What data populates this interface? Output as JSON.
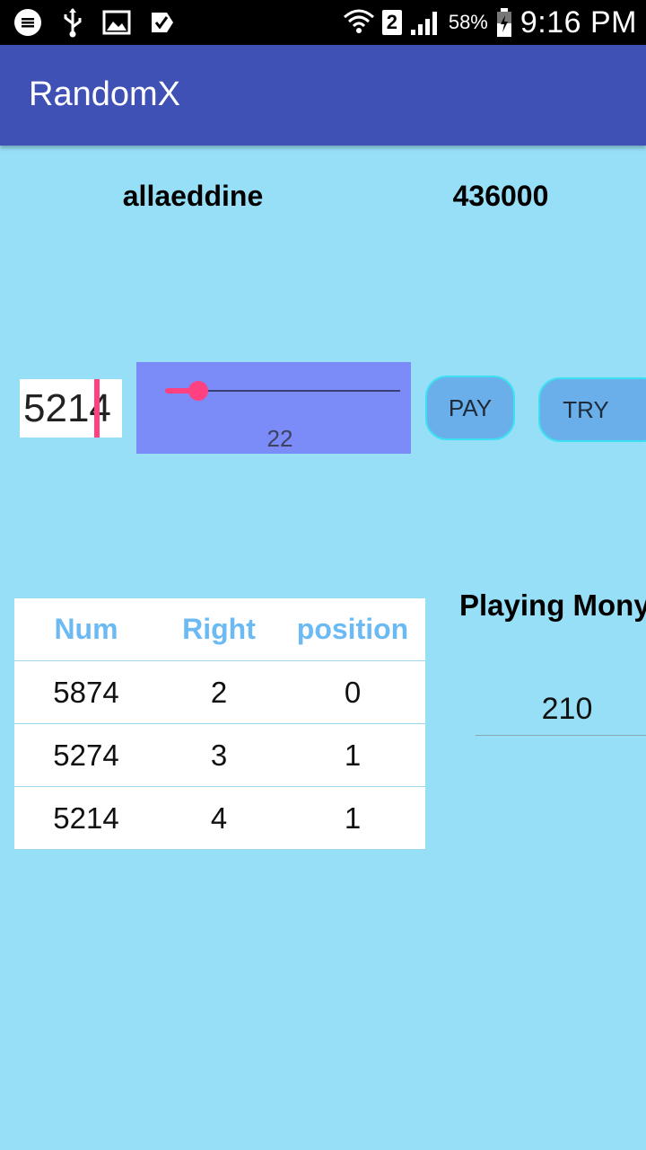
{
  "status_bar": {
    "battery_percent": "58%",
    "sim_slot": "2",
    "time": "9:16 PM",
    "icons": [
      "message-icon",
      "usb-icon",
      "image-icon",
      "checkbox-icon",
      "wifi-icon",
      "signal-icon",
      "battery-icon"
    ]
  },
  "app_bar": {
    "title": "RandomX"
  },
  "player": {
    "name": "allaeddine",
    "score": "436000"
  },
  "guess_input": {
    "value": "5214"
  },
  "slider": {
    "value": "22",
    "min": 0,
    "max": 100,
    "fraction": 0.14
  },
  "buttons": {
    "pay_label": "PAY",
    "try_label": "TRY"
  },
  "history": {
    "headers": [
      "Num",
      "Right",
      "position"
    ],
    "rows": [
      [
        "5874",
        "2",
        "0"
      ],
      [
        "5274",
        "3",
        "1"
      ],
      [
        "5214",
        "4",
        "1"
      ]
    ]
  },
  "playing_money": {
    "label": "Playing Mony",
    "value": "210"
  },
  "colors": {
    "background": "#97dff6",
    "app_bar": "#3f51b5",
    "accent": "#ff4081",
    "slider_panel": "#7b8bf8",
    "button": "#6aaeea",
    "table_header_text": "#6cbaf3"
  }
}
